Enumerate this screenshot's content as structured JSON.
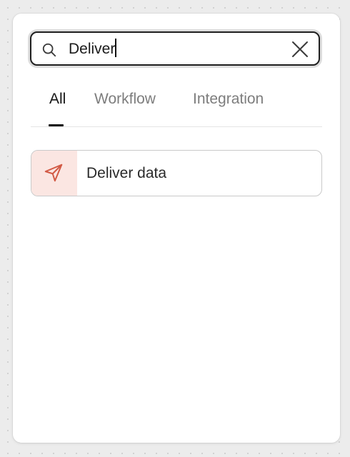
{
  "search": {
    "value": "Deliver",
    "icon": "search-icon",
    "clear_icon": "close-icon"
  },
  "tabs": [
    {
      "label": "All",
      "active": true
    },
    {
      "label": "Workflow",
      "active": false
    },
    {
      "label": "Integration",
      "active": false
    }
  ],
  "results": [
    {
      "label": "Deliver data",
      "icon": "send-icon",
      "icon_color": "#d25a45",
      "icon_bg": "#fbe6e2"
    }
  ],
  "colors": {
    "accent": "#d25a45",
    "active_tab": "#161616",
    "inactive_tab": "#7d7d7d"
  }
}
